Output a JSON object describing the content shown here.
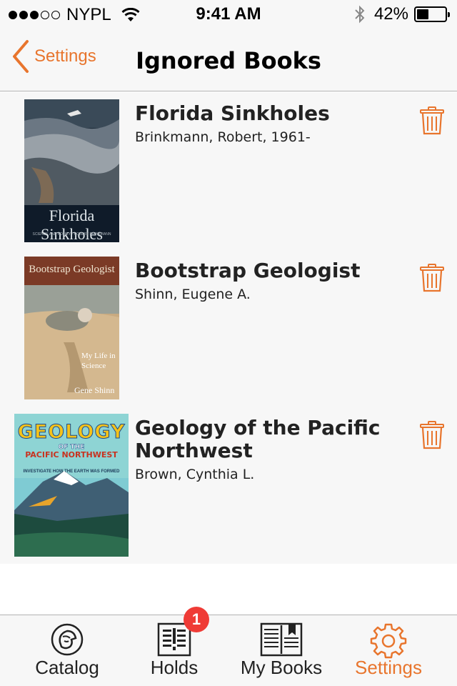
{
  "status_bar": {
    "carrier": "NYPL",
    "time": "9:41 AM",
    "battery_percent": "42%",
    "battery_level": 0.42,
    "signal_bars_filled": 3,
    "signal_bars_total": 5
  },
  "nav": {
    "back_label": "Settings",
    "title": "Ignored Books"
  },
  "books": [
    {
      "title": "Florida Sinkholes",
      "author": "Brinkmann, Robert, 1961-",
      "cover": {
        "title_text": "Florida Sinkholes",
        "subtitle_text": "SCIENCE AND POLICY · ROBERT BRINKMANN"
      }
    },
    {
      "title": "Bootstrap Geologist",
      "author": "Shinn, Eugene A.",
      "cover": {
        "title_text": "Bootstrap Geologist",
        "subtitle_text": "My Life in Science",
        "author_text": "Gene Shinn"
      }
    },
    {
      "title": "Geology of the Pacific Northwest",
      "author": "Brown, Cynthia L.",
      "cover": {
        "title_text": "GEOLOGY",
        "subtitle_text": "OF THE",
        "region_text": "PACIFIC NORTHWEST",
        "tagline_text": "INVESTIGATE HOW THE EARTH WAS FORMED"
      }
    }
  ],
  "tabs": [
    {
      "label": "Catalog",
      "icon": "lion-icon",
      "active": false
    },
    {
      "label": "Holds",
      "icon": "holds-icon",
      "badge": "1",
      "active": false
    },
    {
      "label": "My Books",
      "icon": "book-icon",
      "active": false
    },
    {
      "label": "Settings",
      "icon": "gear-icon",
      "active": true
    }
  ],
  "colors": {
    "accent": "#e8752d",
    "badge": "#ef3b36",
    "bar_background": "#f7f7f7"
  }
}
